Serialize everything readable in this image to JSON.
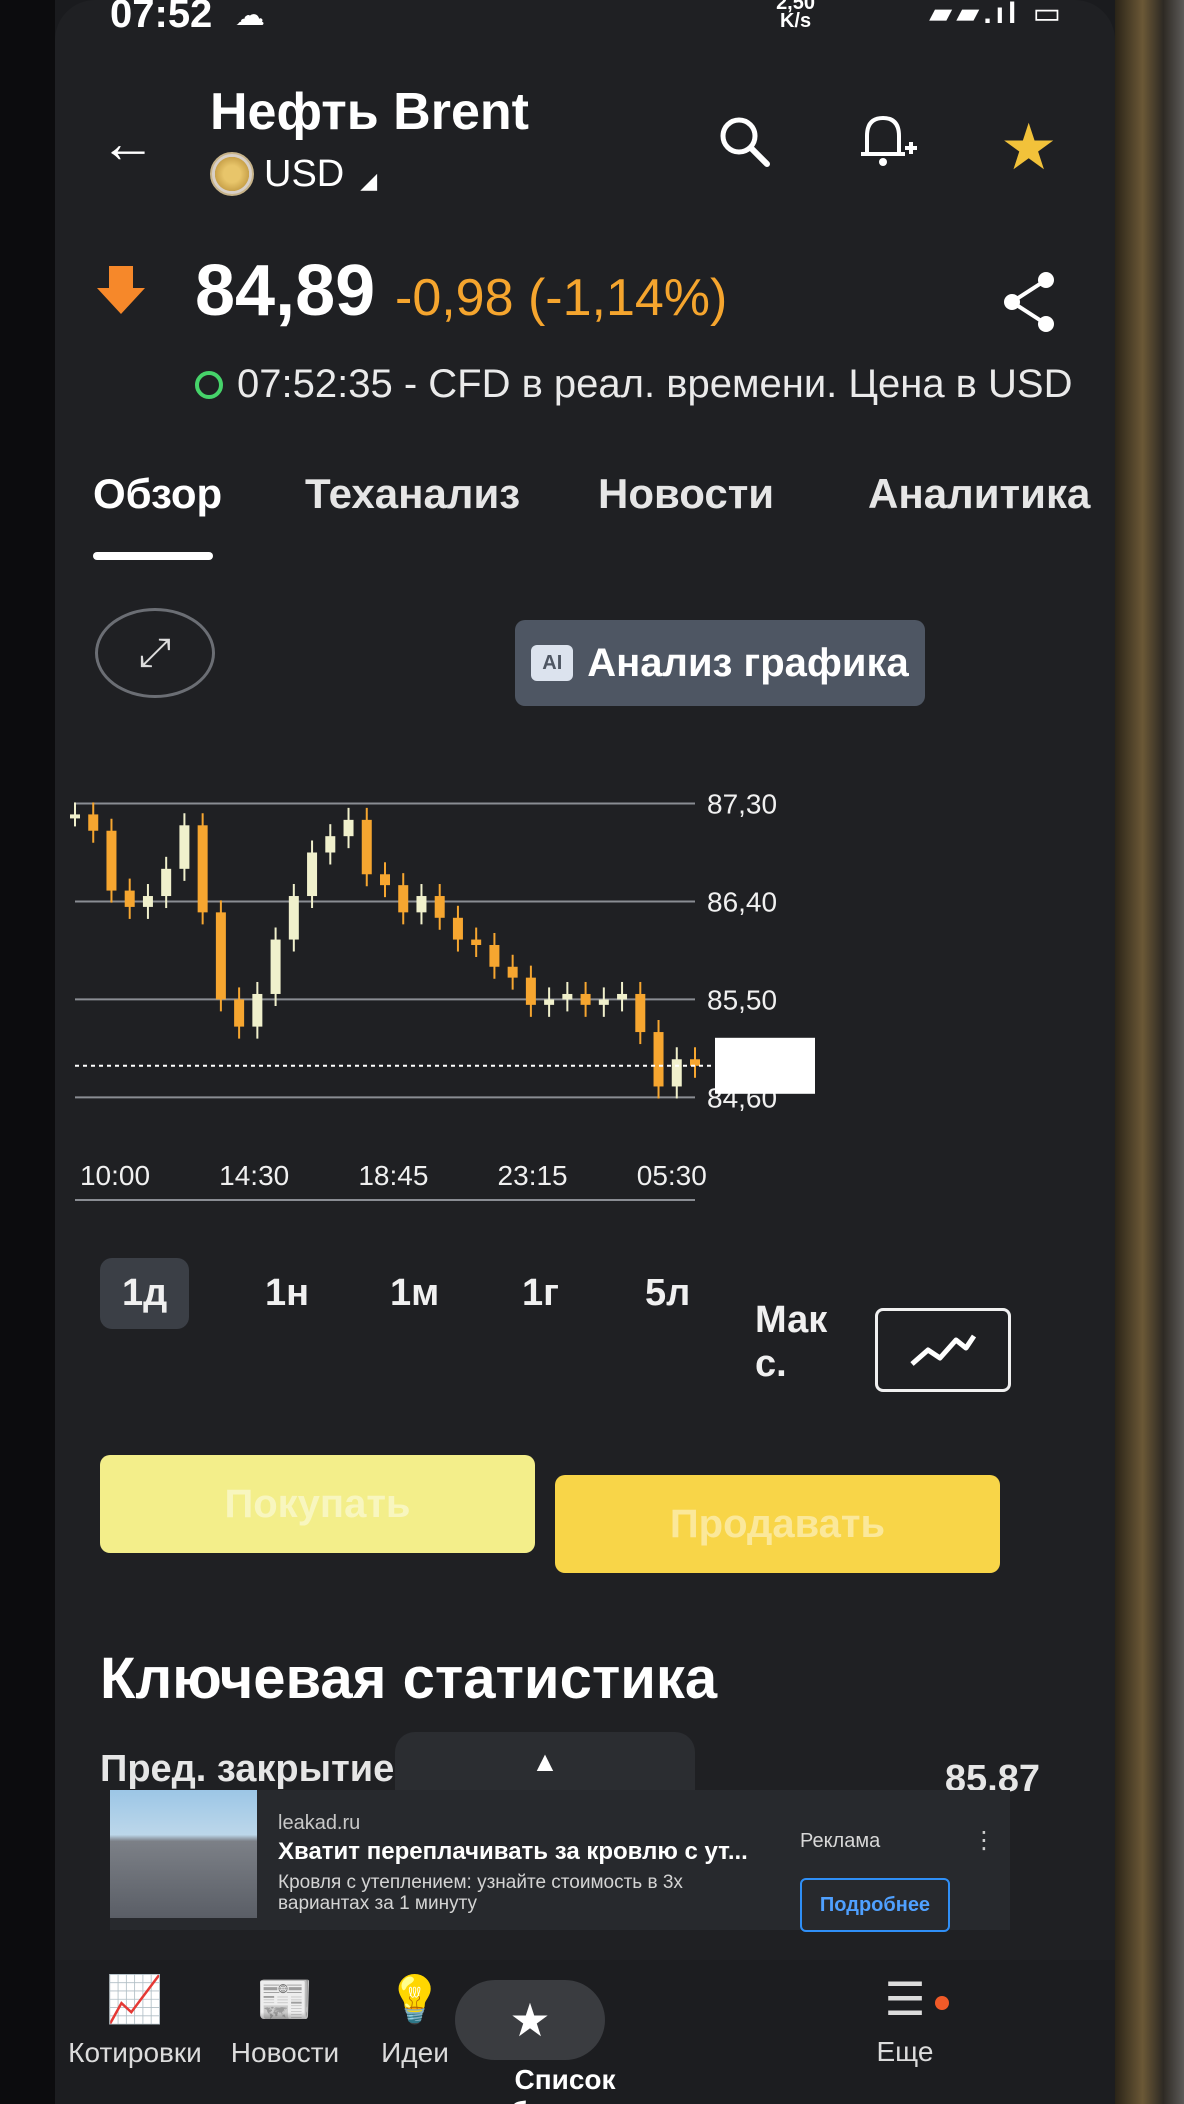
{
  "status": {
    "time": "07:52",
    "speed_top": "2,50",
    "speed_unit": "K/s"
  },
  "header": {
    "title": "Нефть Brent",
    "currency": "USD"
  },
  "quote": {
    "price": "84,89",
    "change": "-0,98 (-1,14%)",
    "realtime": "07:52:35 - CFD в реал. времени. Цена в USD"
  },
  "tabs": [
    {
      "label": "Обзор",
      "active": true
    },
    {
      "label": "Теханализ"
    },
    {
      "label": "Новости"
    },
    {
      "label": "Аналитика"
    }
  ],
  "chart_actions": {
    "ai_label": "Анализ графика",
    "ai_badge": "AI"
  },
  "chart_data": {
    "type": "line",
    "x_labels": [
      "10:00",
      "14:30",
      "18:45",
      "23:15",
      "05:30"
    ],
    "y_labels": [
      "87,30",
      "86,40",
      "85,50",
      "84,60"
    ],
    "ylim": [
      84.3,
      87.7
    ],
    "series": [
      {
        "values": [
          87.2,
          87.05,
          86.5,
          86.35,
          86.45,
          86.7,
          87.1,
          86.3,
          85.5,
          85.25,
          85.55,
          86.05,
          86.45,
          86.85,
          87.0,
          87.15,
          86.65,
          86.55,
          86.3,
          86.45,
          86.25,
          86.05,
          86.0,
          85.8,
          85.7,
          85.45,
          85.5,
          85.55,
          85.45,
          85.5,
          85.55,
          85.2,
          84.7,
          84.95,
          84.89
        ]
      }
    ],
    "current_value": 84.89
  },
  "periods": [
    {
      "label": "1д",
      "active": true
    },
    {
      "label": "1н"
    },
    {
      "label": "1м"
    },
    {
      "label": "1г"
    },
    {
      "label": "5л"
    },
    {
      "label": "Мак\nс."
    }
  ],
  "trade": {
    "buy": "Покупать",
    "sell": "Продавать"
  },
  "stats": {
    "title": "Ключевая статистика",
    "prev_close_label": "Пред. закрытие",
    "prev_close_value": "85,87"
  },
  "ad": {
    "domain": "leakad.ru",
    "headline": "Хватит переплачивать за кровлю с ут...",
    "text": "Кровля с утеплением: узнайте стоимость в 3х вариантах за 1 минуту",
    "label": "Реклама",
    "more": "Подробнее"
  },
  "nav": [
    {
      "label": "Котировки"
    },
    {
      "label": "Новости"
    },
    {
      "label": "Идеи"
    },
    {
      "label": "Список наблюдения"
    },
    {
      "label": "Еще"
    }
  ],
  "colors": {
    "up": "#f0f0cc",
    "down": "#f6a630",
    "accent_star": "#f2c23a",
    "sell": "#f8d548",
    "buy": "#f3ee8a"
  }
}
